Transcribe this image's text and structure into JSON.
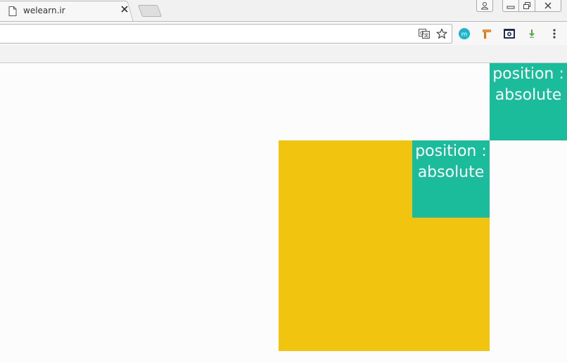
{
  "browser": {
    "tab": {
      "title": "welearn.ir"
    },
    "colors": {
      "frame": "#f1f1f1",
      "toolbar": "#f7f7f7"
    }
  },
  "page": {
    "outer_box": {
      "line1": "position :",
      "line2": "absolute"
    },
    "inner_box": {
      "line1": "position :",
      "line2": "absolute"
    },
    "colors": {
      "yellow": "#f1c40f",
      "green": "#1abc9c",
      "text": "#ffffff",
      "background": "#fcfcfc"
    }
  }
}
